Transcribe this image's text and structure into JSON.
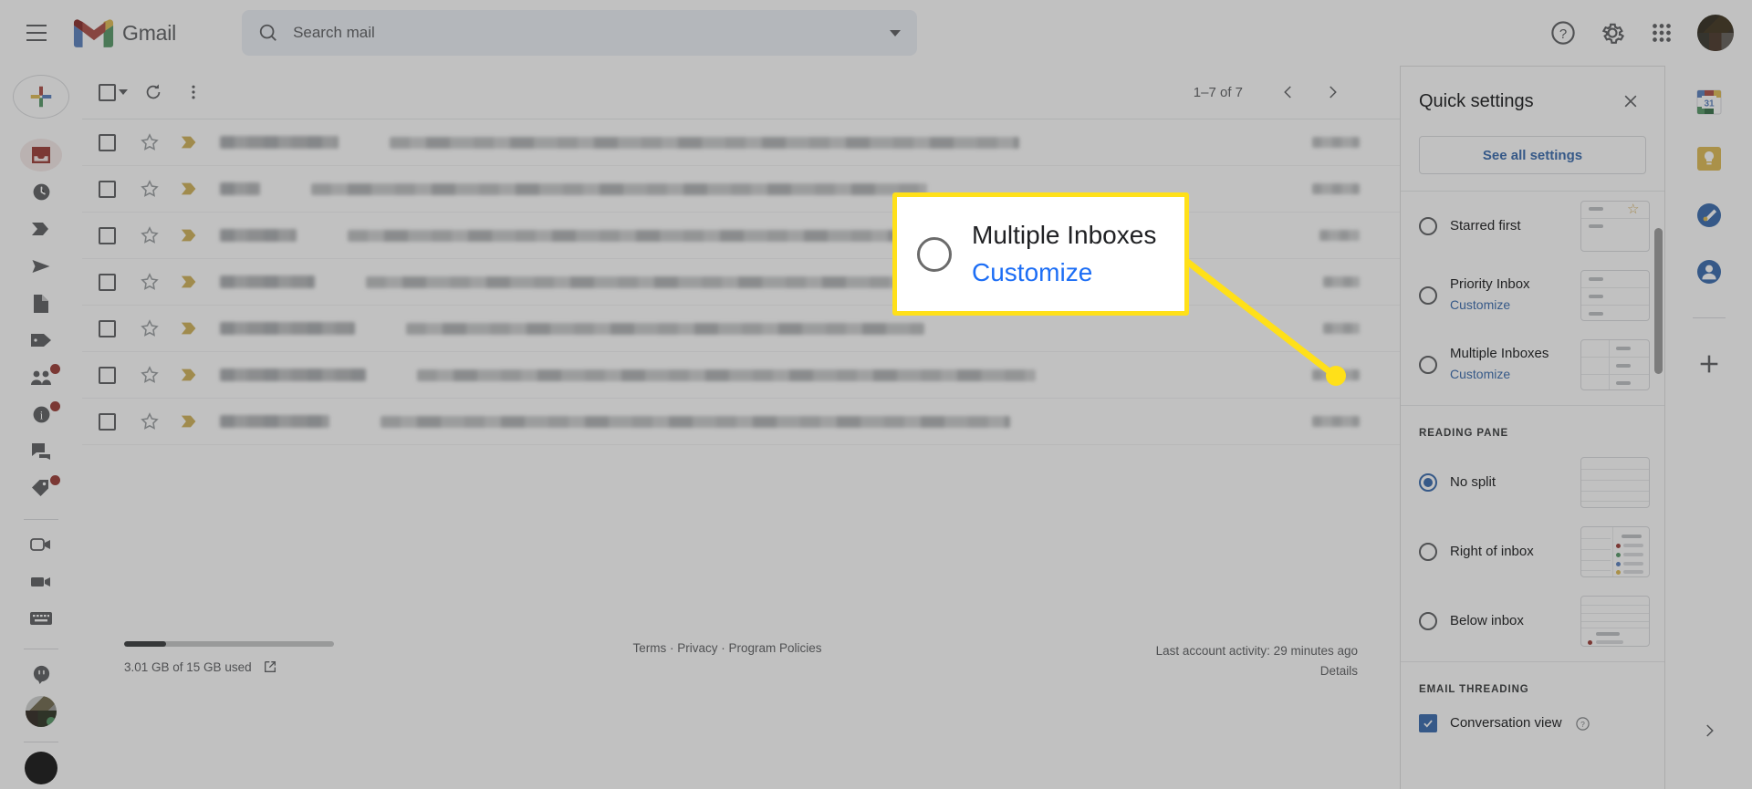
{
  "header": {
    "menu_icon": "hamburger-menu-icon",
    "logo_text": "Gmail",
    "search": {
      "placeholder": "Search mail",
      "value": "",
      "icon": "search-icon",
      "options_icon": "chevron-down-icon"
    },
    "icons": [
      {
        "name": "help-icon",
        "label": "Support"
      },
      {
        "name": "gear-icon",
        "label": "Settings"
      },
      {
        "name": "apps-grid-icon",
        "label": "Google apps"
      },
      {
        "name": "avatar",
        "label": "Google Account"
      }
    ]
  },
  "left_rail": {
    "compose_label": "Compose",
    "items": [
      {
        "name": "sidebar-item-inbox",
        "icon": "inbox-icon",
        "active": true,
        "badge": false
      },
      {
        "name": "sidebar-item-snoozed",
        "icon": "clock-icon",
        "active": false,
        "badge": false
      },
      {
        "name": "sidebar-item-important",
        "icon": "important-chevron-icon",
        "active": false,
        "badge": false
      },
      {
        "name": "sidebar-item-sent",
        "icon": "send-icon",
        "active": false,
        "badge": false
      },
      {
        "name": "sidebar-item-drafts",
        "icon": "draft-file-icon",
        "active": false,
        "badge": false
      },
      {
        "name": "sidebar-item-categories",
        "icon": "label-tag-icon",
        "active": false,
        "badge": false
      },
      {
        "name": "sidebar-item-social",
        "icon": "people-icon",
        "active": false,
        "badge": true
      },
      {
        "name": "sidebar-item-updates",
        "icon": "info-circle-icon",
        "active": false,
        "badge": true
      },
      {
        "name": "sidebar-item-forums",
        "icon": "forum-chat-icon",
        "active": false,
        "badge": false
      },
      {
        "name": "sidebar-item-promotions",
        "icon": "price-tag-icon",
        "active": false,
        "badge": true
      }
    ],
    "meet_items": [
      {
        "name": "sidebar-item-new-meeting",
        "icon": "video-outline-icon"
      },
      {
        "name": "sidebar-item-join-meeting",
        "icon": "video-solid-icon"
      },
      {
        "name": "sidebar-item-keyboard",
        "icon": "keyboard-icon"
      }
    ],
    "chat_items": [
      {
        "name": "sidebar-item-chat",
        "icon": "chat-bubble-icon"
      },
      {
        "name": "sidebar-item-contact-avatar",
        "icon": "contact-avatar"
      },
      {
        "name": "sidebar-item-profile",
        "icon": "profile-avatar-dark"
      }
    ]
  },
  "toolbar": {
    "select_all": "select-all-checkbox",
    "refresh": "refresh-icon",
    "more": "more-vertical-icon",
    "pager_count": "1–7 of 7",
    "prev_icon": "chevron-left-icon",
    "next_icon": "chevron-right-icon"
  },
  "mail_list": {
    "rows": [
      {
        "sender_w": 130,
        "subject_w": 690,
        "date_w": 52,
        "redacted": true
      },
      {
        "sender_w": 44,
        "subject_w": 675,
        "date_w": 52,
        "redacted": true
      },
      {
        "sender_w": 84,
        "subject_w": 700,
        "date_w": 44,
        "redacted": true
      },
      {
        "sender_w": 104,
        "subject_w": 620,
        "date_w": 40,
        "redacted": true
      },
      {
        "sender_w": 148,
        "subject_w": 568,
        "date_w": 40,
        "redacted": true
      },
      {
        "sender_w": 160,
        "subject_w": 678,
        "date_w": 52,
        "redacted": true
      },
      {
        "sender_w": 120,
        "subject_w": 690,
        "date_w": 52,
        "redacted": true
      }
    ]
  },
  "footer": {
    "storage_used_pct": 20,
    "storage_text": "3.01 GB of 15 GB used",
    "storage_open_icon": "open-in-new-icon",
    "links": "Terms · Privacy · Program Policies",
    "activity": "Last account activity: 29 minutes ago",
    "details": "Details"
  },
  "quick_settings": {
    "title": "Quick settings",
    "close_icon": "close-icon",
    "see_all_label": "See all settings",
    "inbox_options": [
      {
        "label": "Starred first",
        "sub": null,
        "selected": false,
        "thumb": "starred-first-thumb"
      },
      {
        "label": "Priority Inbox",
        "sub": "Customize",
        "selected": false,
        "thumb": "priority-inbox-thumb"
      },
      {
        "label": "Multiple Inboxes",
        "sub": "Customize",
        "selected": false,
        "thumb": "multiple-inboxes-thumb"
      }
    ],
    "reading_pane": {
      "section_title": "READING PANE",
      "options": [
        {
          "label": "No split",
          "selected": true,
          "thumb": "no-split-thumb"
        },
        {
          "label": "Right of inbox",
          "selected": false,
          "thumb": "right-of-inbox-thumb"
        },
        {
          "label": "Below inbox",
          "selected": false,
          "thumb": "below-inbox-thumb"
        }
      ]
    },
    "email_threading": {
      "section_title": "EMAIL THREADING",
      "conversation_label": "Conversation view",
      "conversation_checked": true,
      "help_icon": "help-circle-icon"
    }
  },
  "side_apps": {
    "items": [
      {
        "name": "google-calendar-icon",
        "label": "Calendar"
      },
      {
        "name": "google-keep-icon",
        "label": "Keep"
      },
      {
        "name": "google-tasks-icon",
        "label": "Tasks"
      },
      {
        "name": "google-contacts-icon",
        "label": "Contacts"
      },
      {
        "name": "add-app-icon",
        "label": "Get add-ons"
      }
    ],
    "expand_icon": "chevron-right-icon"
  },
  "callout": {
    "label": "Multiple Inboxes",
    "link": "Customize",
    "radio_selected": false,
    "highlight_color": "#ffe019",
    "link_color": "#1d6ef5"
  },
  "colors": {
    "accent_blue": "#1a73e8",
    "highlight_yellow": "#ffe019",
    "gmail_red": "#ea4335",
    "important_yellow": "#e8b417"
  }
}
